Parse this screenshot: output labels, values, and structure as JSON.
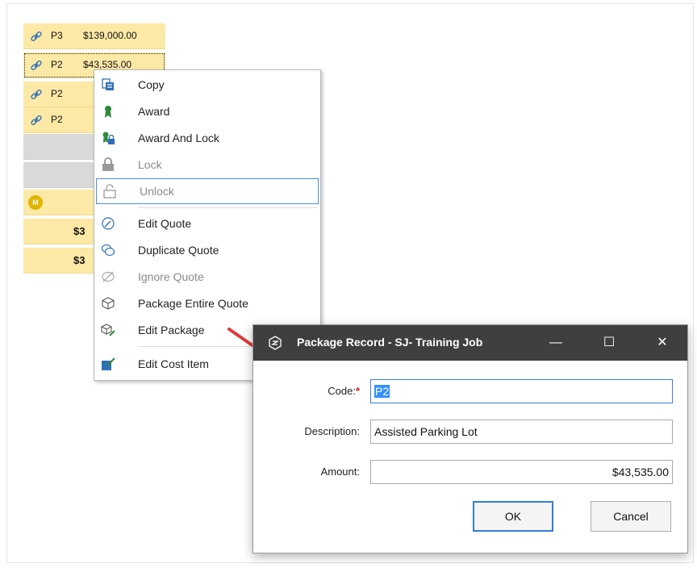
{
  "grid": {
    "rows": [
      {
        "code": "P3",
        "amount": "$139,000.00"
      },
      {
        "code": "P2",
        "amount": "$43,535.00"
      },
      {
        "code": "P2",
        "amount": ""
      },
      {
        "code": "P2",
        "amount": ""
      }
    ],
    "milestone_badge": "M",
    "totals": [
      "$3",
      "$3"
    ]
  },
  "context_menu": {
    "items": [
      {
        "label": "Copy",
        "icon": "copy-icon",
        "enabled": true
      },
      {
        "label": "Award",
        "icon": "award-ribbon-icon",
        "enabled": true
      },
      {
        "label": "Award And Lock",
        "icon": "award-lock-icon",
        "enabled": true
      },
      {
        "label": "Lock",
        "icon": "lock-icon",
        "enabled": false
      },
      {
        "label": "Unlock",
        "icon": "unlock-icon",
        "enabled": false
      },
      {
        "label": "Edit Quote",
        "icon": "edit-quote-icon",
        "enabled": true
      },
      {
        "label": "Duplicate Quote",
        "icon": "duplicate-quote-icon",
        "enabled": true
      },
      {
        "label": "Ignore Quote",
        "icon": "ignore-quote-icon",
        "enabled": false
      },
      {
        "label": "Package Entire Quote",
        "icon": "package-icon",
        "enabled": true
      },
      {
        "label": "Edit Package",
        "icon": "edit-package-icon",
        "enabled": true
      },
      {
        "label": "Edit Cost Item",
        "icon": "edit-cost-item-icon",
        "enabled": true
      }
    ]
  },
  "dialog": {
    "title": "Package Record - SJ- Training Job",
    "code_label": "Code:",
    "required_mark": "*",
    "code_value": "P2",
    "description_label": "Description:",
    "description_value": "Assisted Parking Lot",
    "amount_label": "Amount:",
    "amount_value": "$43,535.00",
    "ok_label": "OK",
    "cancel_label": "Cancel",
    "minimize_symbol": "—",
    "maximize_symbol": "☐",
    "close_symbol": "✕"
  },
  "colors": {
    "row_highlight": "#fde9a6",
    "title_bar": "#3f3f3f",
    "accent": "#3390ff",
    "arrow": "#e03a3a"
  }
}
